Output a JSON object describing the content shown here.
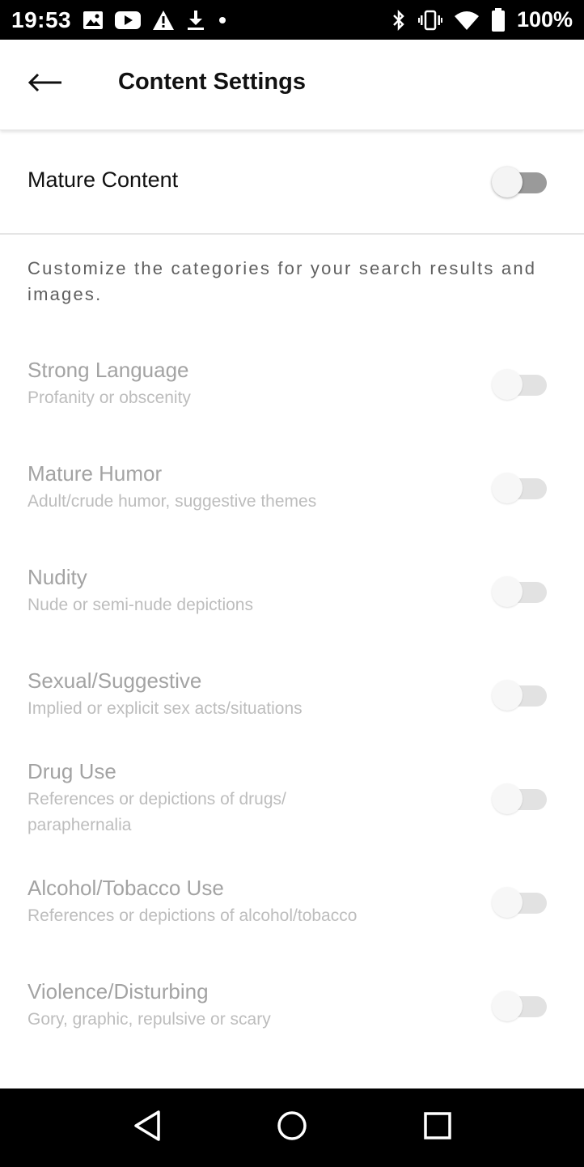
{
  "status_bar": {
    "time": "19:53",
    "battery": "100%"
  },
  "header": {
    "title": "Content Settings"
  },
  "mature": {
    "label": "Mature Content",
    "enabled": false
  },
  "description": "Customize the categories for your search results and images.",
  "categories": [
    {
      "title": "Strong Language",
      "subtitle": "Profanity or obscenity",
      "enabled": false
    },
    {
      "title": "Mature Humor",
      "subtitle": "Adult/crude humor, suggestive themes",
      "enabled": false
    },
    {
      "title": "Nudity",
      "subtitle": "Nude or semi-nude depictions",
      "enabled": false
    },
    {
      "title": "Sexual/Suggestive",
      "subtitle": "Implied or explicit sex acts/situations",
      "enabled": false
    },
    {
      "title": "Drug Use",
      "subtitle": "References or depictions of drugs/ paraphernalia",
      "enabled": false
    },
    {
      "title": "Alcohol/Tobacco Use",
      "subtitle": "References or depictions of alcohol/tobacco",
      "enabled": false
    },
    {
      "title": "Violence/Disturbing",
      "subtitle": "Gory, graphic, repulsive or scary",
      "enabled": false
    }
  ],
  "colors": {
    "title_text": "#111111",
    "disabled_title": "#a3a3a3",
    "disabled_subtitle": "#bdbdbd",
    "switch_track_off": "#9a9a9a"
  },
  "icons": {
    "back": "arrow-left-icon",
    "nav_back": "triangle-back-icon",
    "nav_home": "circle-home-icon",
    "nav_recents": "square-recents-icon"
  }
}
